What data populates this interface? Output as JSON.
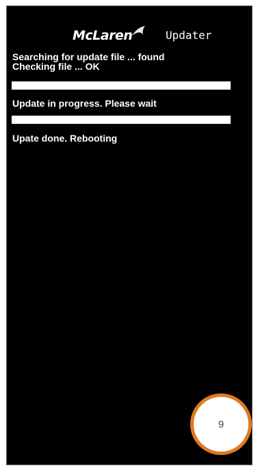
{
  "header": {
    "brand_logo_text": "McLaren",
    "app_name": "Updater"
  },
  "log": {
    "line1": "Searching for update file ... found",
    "line2": "Checking file ... OK",
    "line3": "Update in progress. Please wait",
    "line4": "Upate done. Rebooting"
  },
  "progress": {
    "check_bar_fraction": 1.0,
    "update_bar_fraction": 1.0
  },
  "annotation": {
    "step_number": "9"
  },
  "colors": {
    "screen_background": "#000000",
    "text": "#ffffff",
    "marker_ring": "#e07a1f"
  }
}
